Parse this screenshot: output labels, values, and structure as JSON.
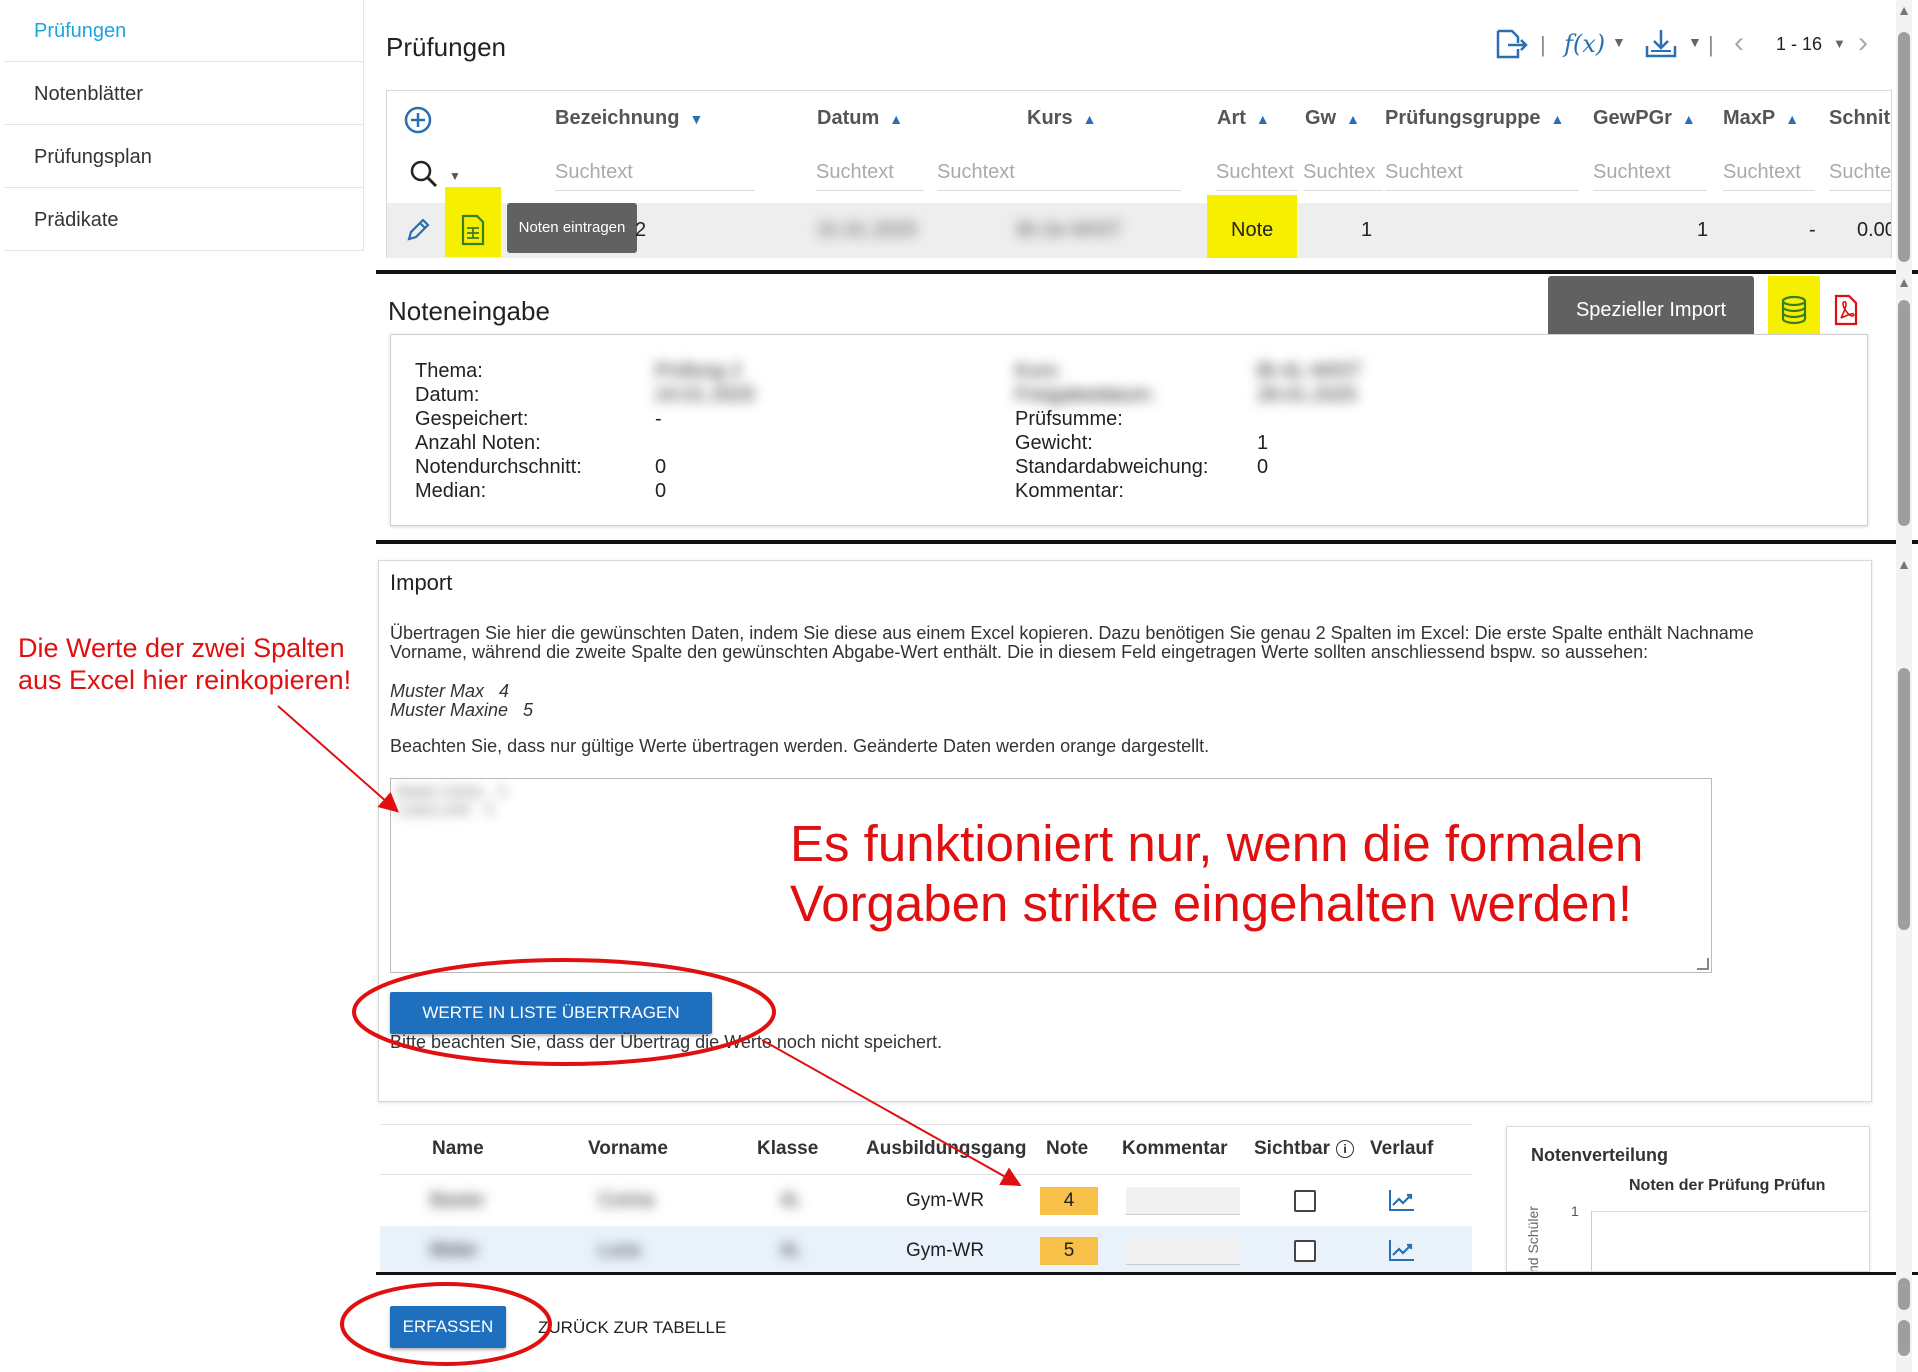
{
  "sidebar": {
    "items": [
      {
        "label": "Prüfungen"
      },
      {
        "label": "Notenblätter"
      },
      {
        "label": "Prüfungsplan"
      },
      {
        "label": "Prädikate"
      }
    ]
  },
  "header": {
    "title": "Prüfungen",
    "pagination": "1 - 16",
    "fx_label": "f(x)"
  },
  "grid": {
    "columns": [
      {
        "label": "Bezeichnung"
      },
      {
        "label": "Datum"
      },
      {
        "label": "Kurs"
      },
      {
        "label": "Art"
      },
      {
        "label": "Gw"
      },
      {
        "label": "Prüfungsgruppe"
      },
      {
        "label": "GewPGr"
      },
      {
        "label": "MaxP"
      },
      {
        "label": "Schnit"
      }
    ],
    "filter_placeholder": "Suchtext",
    "filter_placeholders": [
      "Suchtext",
      "Suchtext",
      "Suchtext",
      "Suchtext",
      "Suchtex",
      "Suchtext",
      "Suchtext",
      "Suchtext",
      "Suchte"
    ],
    "row": {
      "bezeichnung": "Prüfung 2",
      "bezeichnung_visible": "2",
      "datum": "31.01.2025",
      "kurs": "BI-2e-WIST",
      "art": "Note",
      "gw": "1",
      "gewpgr": "1",
      "maxp": "-",
      "schnitt": "0.00"
    },
    "tooltip": "Noten eintragen"
  },
  "noteneingabe": {
    "title": "Noteneingabe",
    "tooltip": "Spezieller Import",
    "left": [
      {
        "label": "Thema:",
        "value": "Prüfung 2",
        "blur": true
      },
      {
        "label": "Datum:",
        "value": "24.01.2025",
        "blur": true
      },
      {
        "label": "Gespeichert:",
        "value": "-"
      },
      {
        "label": "Anzahl Noten:",
        "value": ""
      },
      {
        "label": "Notendurchschnitt:",
        "value": "0"
      },
      {
        "label": "Median:",
        "value": "0"
      }
    ],
    "right": [
      {
        "label": "Kurs:",
        "value": "BI-4L-WIST",
        "blur": true
      },
      {
        "label": "Freigabedatum:",
        "value": "28.01.2025",
        "blur": true
      },
      {
        "label": "Prüfsumme:",
        "value": ""
      },
      {
        "label": "Gewicht:",
        "value": "1"
      },
      {
        "label": "Standardabweichung:",
        "value": "0"
      },
      {
        "label": "Kommentar:",
        "value": ""
      }
    ]
  },
  "import": {
    "title": "Import",
    "description": "Übertragen Sie hier die gewünschten Daten, indem Sie diese aus einem Excel kopieren. Dazu benötigen Sie genau 2 Spalten im Excel: Die erste Spalte enthält Nachname Vorname, während die zweite Spalte den gewünschten Abgabe-Wert enthält. Die in diesem Feld eingetragen Werte sollten anschliessend bspw. so aussehen:",
    "example1": "Muster Max   4",
    "example2": "Muster Maxine   5",
    "hint": "Beachten Sie, dass nur gültige Werte übertragen werden. Geänderte Daten werden orange dargestellt.",
    "textarea_line1": "Baxter Corina    4",
    "textarea_line2": "Luana Lenk    5",
    "button": "WERTE IN LISTE ÜBERTRAGEN",
    "note": "Bitte beachten Sie, dass der Übertrag die Werte noch nicht speichert."
  },
  "table": {
    "headers": [
      "Name",
      "Vorname",
      "Klasse",
      "Ausbildungsgang",
      "Note",
      "Kommentar",
      "Sichtbar",
      "Verlauf"
    ],
    "rows": [
      {
        "name": "Baxter",
        "vorname": "Corina",
        "klasse": "4L",
        "ausbildungsgang": "Gym-WR",
        "note": "4"
      },
      {
        "name": "Bilder",
        "vorname": "Luna",
        "klasse": "4L",
        "ausbildungsgang": "Gym-WR",
        "note": "5"
      }
    ]
  },
  "chart": {
    "title": "Notenverteilung",
    "subtitle": "Noten der Prüfung Prüfun",
    "ylabel": "nd Schüler",
    "ytick": "1"
  },
  "footer": {
    "save": "ERFASSEN",
    "back": "ZURÜCK ZUR TABELLE"
  },
  "annotations": {
    "left_line1": "Die Werte der zwei Spalten",
    "left_line2": "aus Excel hier reinkopieren!",
    "big_line1": "Es funktioniert nur, wenn die formalen",
    "big_line2": "Vorgaben strikte eingehalten werden!"
  },
  "colors": {
    "accent": "#1ea3dc",
    "button": "#1f6fbf",
    "highlight": "#f6f000",
    "changed": "#f7c149",
    "annotation": "#e01010"
  }
}
